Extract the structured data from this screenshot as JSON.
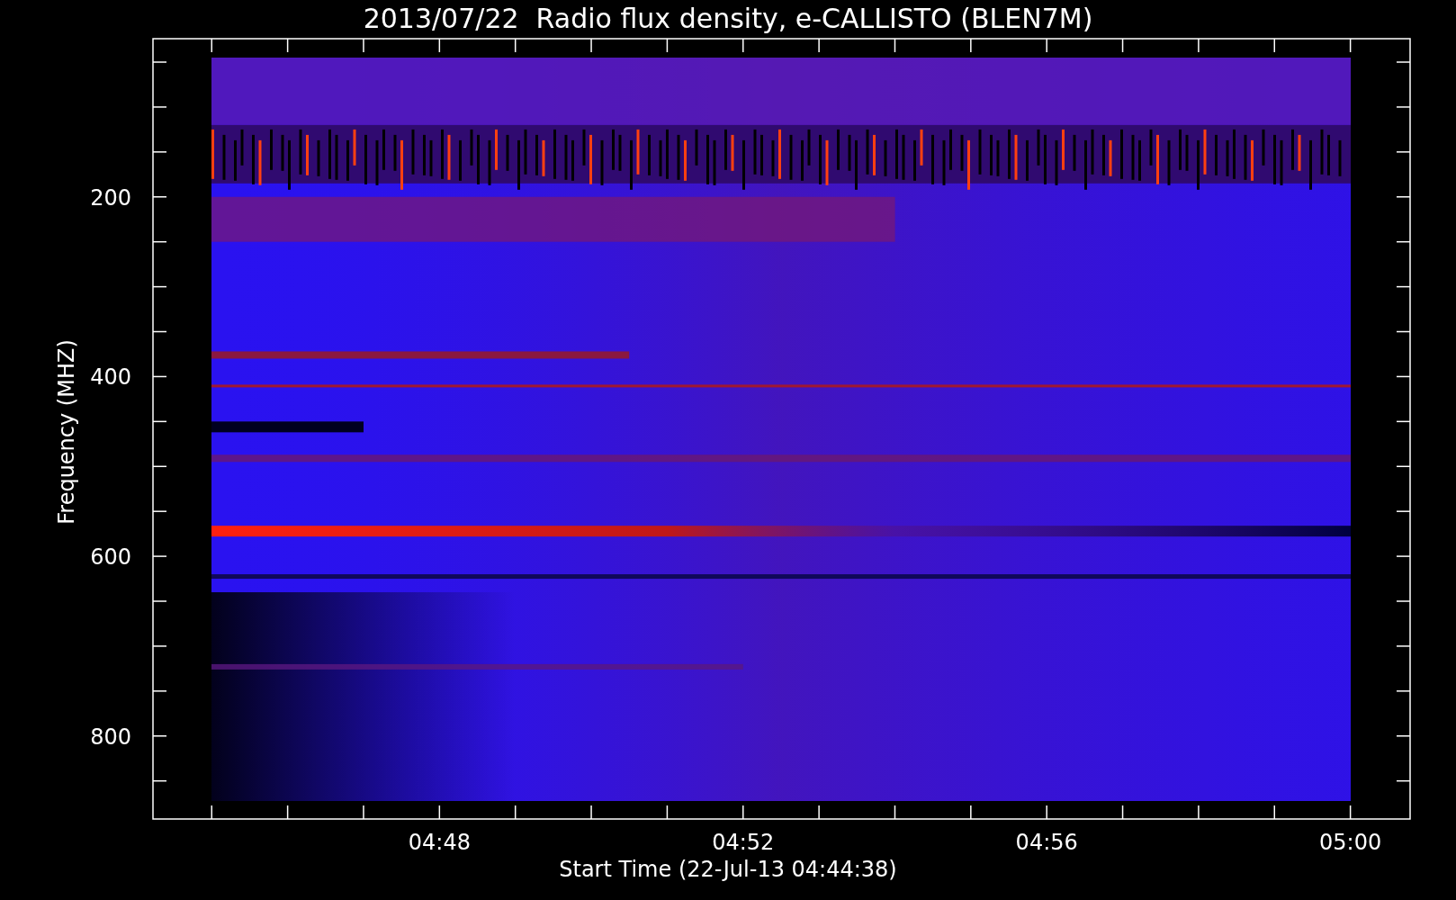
{
  "title": "2013/07/22  Radio flux density, e-CALLISTO (BLEN7M)",
  "plot": {
    "ylabel": "Frequency (MHZ)",
    "xlabel": "Start Time (22-Jul-13 04:44:38)",
    "yticks": [
      "200",
      "400",
      "600",
      "800"
    ],
    "xticks": [
      "04:48",
      "04:52",
      "04:56",
      "05:00"
    ]
  }
}
